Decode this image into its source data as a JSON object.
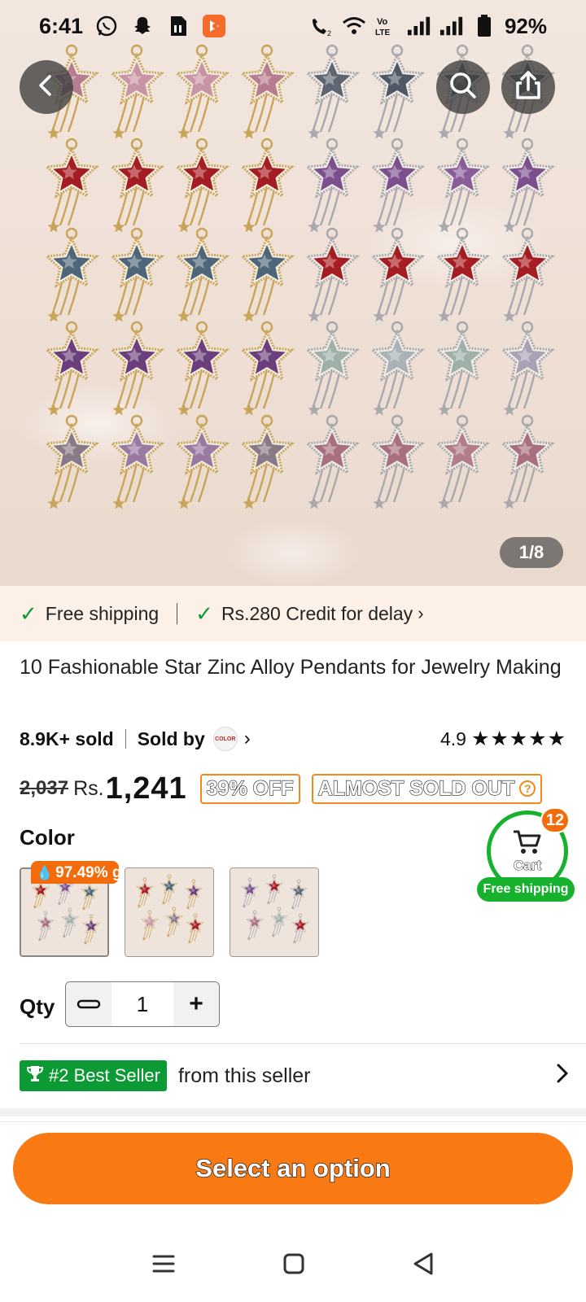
{
  "status_bar": {
    "time": "6:41",
    "battery": "92%",
    "icons": [
      "whatsapp-icon",
      "snapchat-icon",
      "sim-card-icon",
      "app-notification-icon",
      "wifi-call-icon",
      "wifi-icon",
      "volte-icon",
      "signal-icon",
      "signal-icon",
      "battery-icon"
    ]
  },
  "hero": {
    "counter": "1/8",
    "buttons": [
      "back-icon",
      "search-icon",
      "share-icon"
    ]
  },
  "shipping": {
    "free_shipping": "Free shipping",
    "credit": "Rs.280 Credit for delay"
  },
  "product": {
    "title": "10 Fashionable Star Zinc Alloy Pendants for Jewelry Making",
    "sold": "8.9K+ sold",
    "sold_by": "Sold by",
    "seller_logo_text": "COLOR",
    "rating": "4.9",
    "stars": "★★★★★",
    "old_price": "2,037",
    "currency": "Rs.",
    "price": "1,241",
    "discount": "39% OFF",
    "stock_badge": "ALMOST SOLD OUT"
  },
  "color": {
    "label": "Color",
    "tag": "97.49% g",
    "swatch_count": 3
  },
  "cart": {
    "count": "12",
    "label": "Cart",
    "shipping": "Free shipping"
  },
  "qty": {
    "label": "Qty",
    "value": "1",
    "minus": "−",
    "plus": "+"
  },
  "best_seller": {
    "badge": "#2 Best Seller",
    "text": "from this seller"
  },
  "cta": {
    "label": "Select an option"
  },
  "colors": {
    "accent": "#f97a12",
    "green": "#16b12d",
    "strip_bg": "#fdf0e6"
  }
}
